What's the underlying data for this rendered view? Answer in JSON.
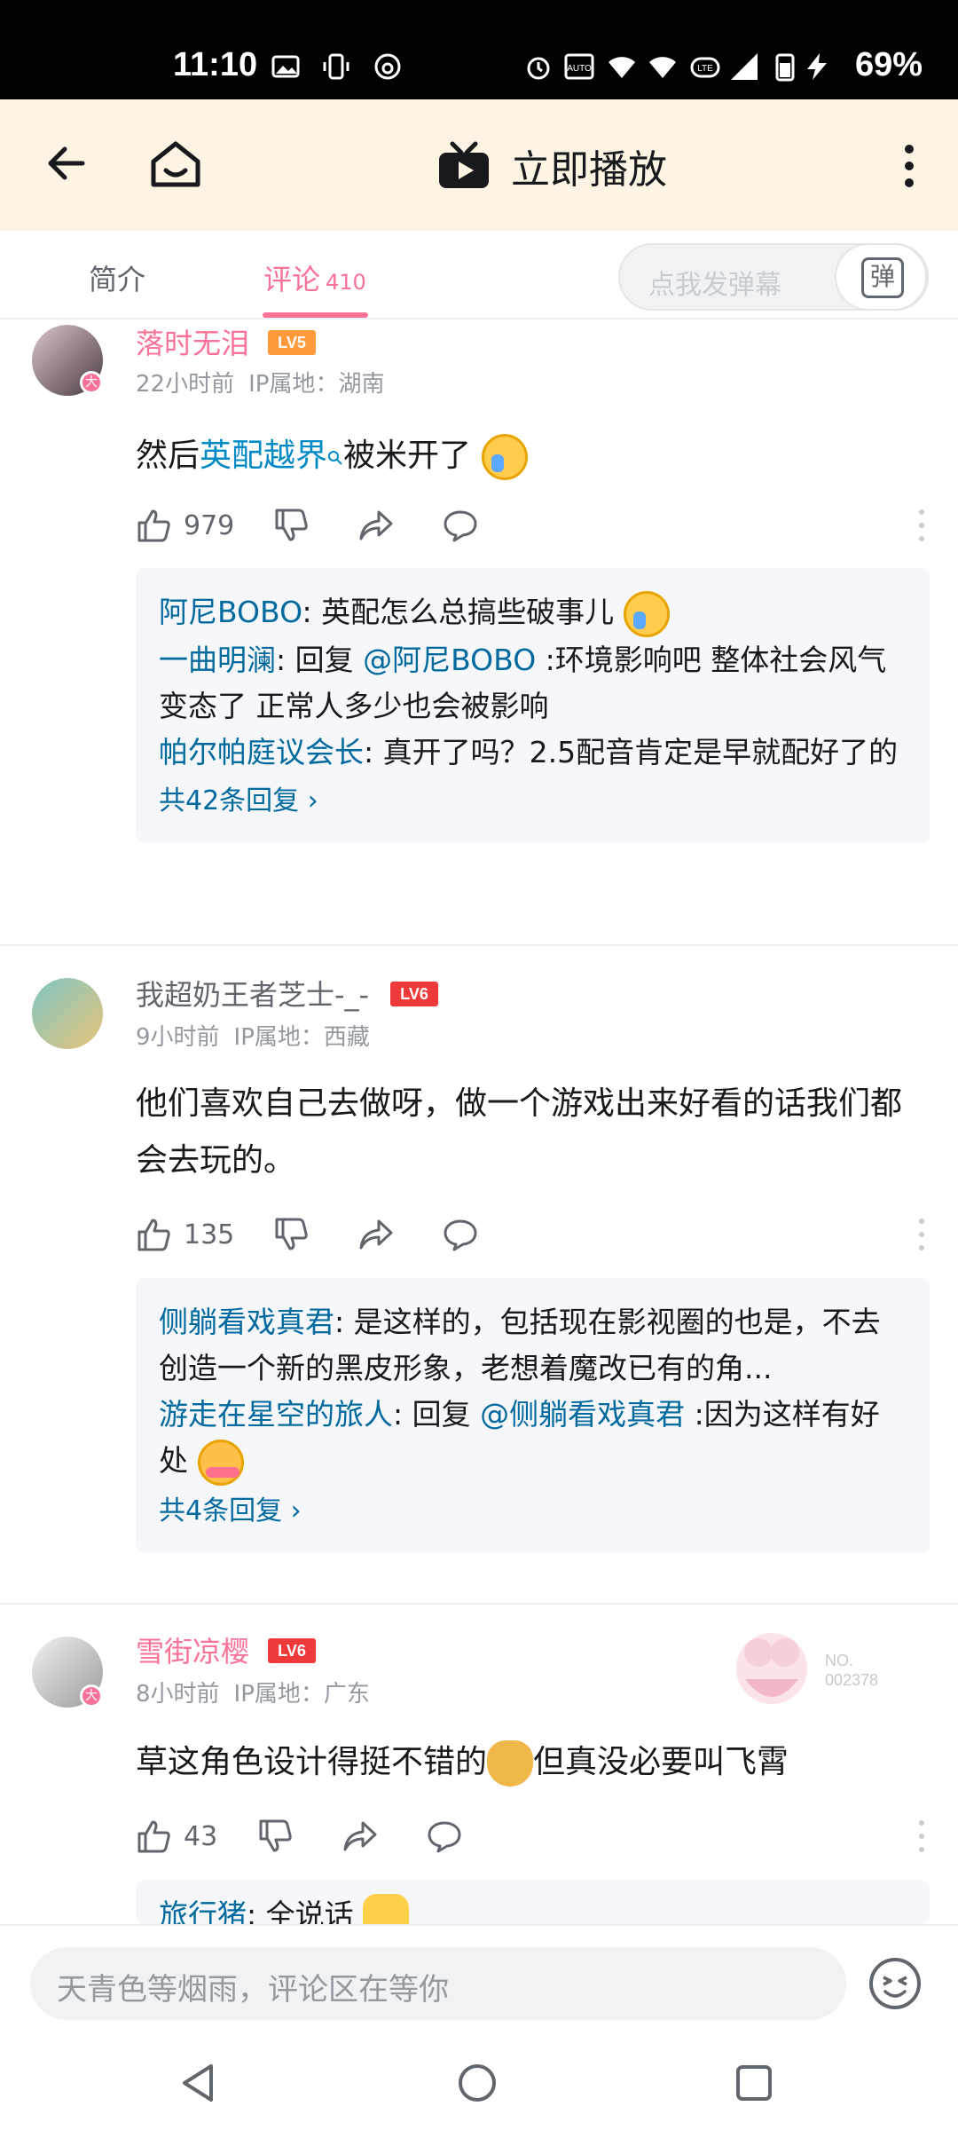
{
  "status_bar": {
    "time": "11:10",
    "battery": "69%"
  },
  "top_bar": {
    "play_label": "立即播放"
  },
  "tabs": {
    "intro": "简介",
    "comments": "评论",
    "comments_count": "410",
    "danmaku_placeholder": "点我发弹幕",
    "danmaku_button": "弹"
  },
  "comments": [
    {
      "user": "落时无泪",
      "level": "LV5",
      "time": "22小时前",
      "ip": "IP属地：湖南",
      "text_before": "然后",
      "text_link": "英配越界",
      "text_after": "被米开了",
      "likes": "979",
      "replies": [
        {
          "who": "阿尼BOBO",
          "text": ": 英配怎么总搞些破事儿"
        },
        {
          "who": "一曲明澜",
          "text_prefix": ": 回复 ",
          "at": "@阿尼BOBO",
          "text": " :环境影响吧 整体社会风气变态了 正常人多少也会被影响"
        },
        {
          "who": "帕尔帕庭议会长",
          "text": ": 真开了吗？2.5配音肯定是早就配好了的"
        }
      ],
      "more_replies": "共42条回复 ›"
    },
    {
      "user": "我超奶王者芝士-_-",
      "level": "LV6",
      "time": "9小时前",
      "ip": "IP属地：西藏",
      "text": "他们喜欢自己去做呀，做一个游戏出来好看的话我们都会去玩的。",
      "likes": "135",
      "replies": [
        {
          "who": "侧躺看戏真君",
          "text": ": 是这样的，包括现在影视圈的也是，不去创造一个新的黑皮形象，老想着魔改已有的角..."
        },
        {
          "who": "游走在星空的旅人",
          "text_prefix": ": 回复 ",
          "at": "@侧躺看戏真君",
          "text": " :因为这样有好处"
        }
      ],
      "more_replies": "共4条回复 ›"
    },
    {
      "user": "雪街凉樱",
      "level": "LV6",
      "time": "8小时前",
      "ip": "IP属地：广东",
      "text_before": "草这角色设计得挺不错的",
      "text_after": "但真没必要叫飞霄",
      "likes": "43",
      "fan_no": "NO.\n002378",
      "partial_reply_who": "旅行猪",
      "partial_reply_text": ": 全说话"
    }
  ],
  "bottom_input": {
    "placeholder": "天青色等烟雨，评论区在等你"
  },
  "colors": {
    "accent": "#fb7299",
    "link": "#00699d",
    "topbar_bg": "#fdf4e4"
  }
}
